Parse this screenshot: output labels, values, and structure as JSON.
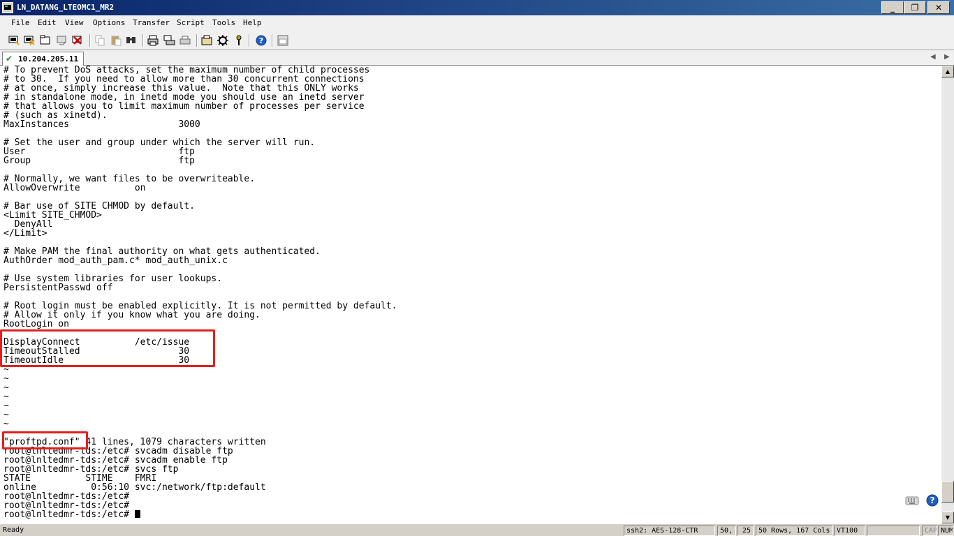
{
  "window": {
    "title": "LN_DATANG_LTEOMC1_MR2",
    "controls": [
      "_",
      "❐",
      "✕"
    ]
  },
  "menu": [
    "File",
    "Edit",
    "View",
    "Options",
    "Transfer",
    "Script",
    "Tools",
    "Help"
  ],
  "toolbar": {
    "icons": [
      "connect-icon",
      "quick-connect-icon",
      "connect-tab-icon",
      "reconnect-icon",
      "disconnect-icon",
      "copy-icon",
      "paste-icon",
      "find-icon",
      "print-icon",
      "print-screen-icon",
      "print-setup-icon",
      "session-options-icon",
      "global-options-icon",
      "keymap-icon",
      "help-icon",
      "sftp-icon"
    ]
  },
  "tabs": [
    {
      "label": "10.204.205.11",
      "status": "connected",
      "active": true
    }
  ],
  "terminal": {
    "lines": [
      "# To prevent DoS attacks, set the maximum number of child processes",
      "# to 30.  If you need to allow more than 30 concurrent connections",
      "# at once, simply increase this value.  Note that this ONLY works",
      "# in standalone mode, in inetd mode you should use an inetd server",
      "# that allows you to limit maximum number of processes per service",
      "# (such as xinetd).",
      "MaxInstances                    3000",
      "",
      "# Set the user and group under which the server will run.",
      "User                            ftp",
      "Group                           ftp",
      "",
      "# Normally, we want files to be overwriteable.",
      "AllowOverwrite          on",
      "",
      "# Bar use of SITE CHMOD by default.",
      "<Limit SITE_CHMOD>",
      "  DenyAll",
      "</Limit>",
      "",
      "# Make PAM the final authority on what gets authenticated.",
      "AuthOrder mod_auth_pam.c* mod_auth_unix.c",
      "",
      "# Use system libraries for user lookups.",
      "PersistentPasswd off",
      "",
      "# Root login must be enabled explicitly. It is not permitted by default.",
      "# Allow it only if you know what you are doing.",
      "RootLogin on",
      "",
      "DisplayConnect          /etc/issue",
      "TimeoutStalled                  30",
      "TimeoutIdle                     30",
      "~",
      "~",
      "~",
      "~",
      "~",
      "~",
      "~",
      "",
      "\"proftpd.conf\" 41 lines, 1079 characters written",
      "root@lnltedmr-tds:/etc# svcadm disable ftp",
      "root@lnltedmr-tds:/etc# svcadm enable ftp",
      "root@lnltedmr-tds:/etc# svcs ftp",
      "STATE          STIME    FMRI",
      "online          0:56:10 svc:/network/ftp:default",
      "root@lnltedmr-tds:/etc#",
      "root@lnltedmr-tds:/etc#",
      "root@lnltedmr-tds:/etc# "
    ]
  },
  "colors": {
    "highlight": "#e0201e",
    "titlebar": "#0a246a"
  },
  "status": {
    "ready": "Ready",
    "protocol": "ssh2: AES-128-CTR",
    "cursor_row": "50,",
    "cursor_col": "25",
    "size": "50 Rows, 167 Cols",
    "emulation": "VT100",
    "blank": "",
    "cap": "CAP",
    "num": "NUM"
  }
}
